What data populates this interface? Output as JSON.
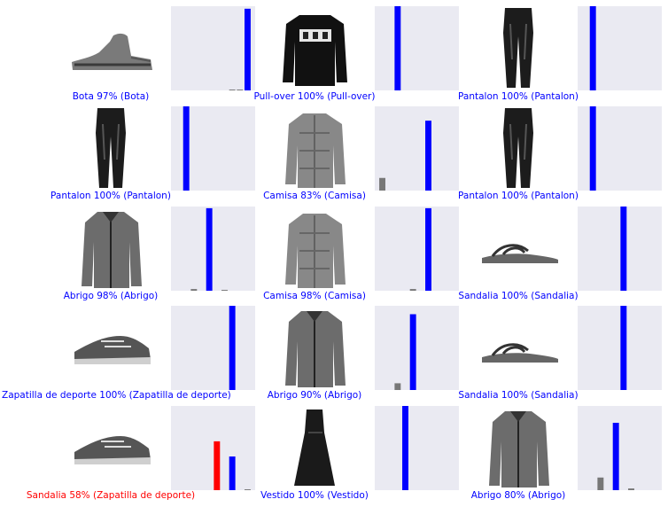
{
  "colors": {
    "panel_bg": "#eaeaf2",
    "correct": "#0000ff",
    "wrong": "#ff0000",
    "other": "#777777"
  },
  "chart_data": {
    "type": "bar",
    "description_note": "",
    "items": [
      {
        "image": "ankle-boot",
        "caption": "Bota 97% (Bota)",
        "correct": true,
        "values": [
          0,
          0,
          0,
          0,
          0,
          0,
          0,
          0.01,
          0.01,
          0.97
        ],
        "predicted": 9,
        "true_label": 9
      },
      {
        "image": "pullover",
        "caption": "Pull-over 100% (Pull-over)",
        "correct": true,
        "values": [
          0,
          0,
          1.0,
          0,
          0,
          0,
          0,
          0,
          0,
          0
        ],
        "predicted": 2,
        "true_label": 2
      },
      {
        "image": "trouser",
        "caption": "Pantalon 100% (Pantalon)",
        "correct": true,
        "values": [
          0,
          1.0,
          0,
          0,
          0,
          0,
          0,
          0,
          0,
          0
        ],
        "predicted": 1,
        "true_label": 1
      },
      {
        "image": "trouser",
        "caption": "Pantalon 100% (Pantalon)",
        "correct": true,
        "values": [
          0,
          1.0,
          0,
          0,
          0,
          0,
          0,
          0,
          0,
          0
        ],
        "predicted": 1,
        "true_label": 1
      },
      {
        "image": "shirt",
        "caption": "Camisa 83% (Camisa)",
        "correct": true,
        "values": [
          0.15,
          0,
          0,
          0,
          0,
          0,
          0.83,
          0,
          0,
          0
        ],
        "predicted": 6,
        "true_label": 6
      },
      {
        "image": "trouser",
        "caption": "Pantalon 100% (Pantalon)",
        "correct": true,
        "values": [
          0,
          1.0,
          0,
          0,
          0,
          0,
          0,
          0,
          0,
          0
        ],
        "predicted": 1,
        "true_label": 1
      },
      {
        "image": "coat",
        "caption": "Abrigo 98% (Abrigo)",
        "correct": true,
        "values": [
          0,
          0,
          0.02,
          0,
          0.98,
          0,
          0.01,
          0,
          0,
          0
        ],
        "predicted": 4,
        "true_label": 4
      },
      {
        "image": "shirt",
        "caption": "Camisa 98% (Camisa)",
        "correct": true,
        "values": [
          0,
          0,
          0,
          0,
          0.02,
          0,
          0.98,
          0,
          0,
          0
        ],
        "predicted": 6,
        "true_label": 6
      },
      {
        "image": "sandal",
        "caption": "Sandalia 100% (Sandalia)",
        "correct": true,
        "values": [
          0,
          0,
          0,
          0,
          0,
          1.0,
          0,
          0,
          0,
          0
        ],
        "predicted": 5,
        "true_label": 5
      },
      {
        "image": "sneaker",
        "caption": "Zapatilla de deporte 100% (Zapatilla de deporte)",
        "correct": true,
        "values": [
          0,
          0,
          0,
          0,
          0,
          0,
          0,
          1.0,
          0,
          0
        ],
        "predicted": 7,
        "true_label": 7
      },
      {
        "image": "coat",
        "caption": "Abrigo 90% (Abrigo)",
        "correct": true,
        "values": [
          0,
          0,
          0.08,
          0,
          0.9,
          0,
          0,
          0,
          0,
          0
        ],
        "predicted": 4,
        "true_label": 4
      },
      {
        "image": "sandal",
        "caption": "Sandalia 100% (Sandalia)",
        "correct": true,
        "values": [
          0,
          0,
          0,
          0,
          0,
          1.0,
          0,
          0,
          0,
          0
        ],
        "predicted": 5,
        "true_label": 5
      },
      {
        "image": "sneaker",
        "caption": "Sandalia 58% (Zapatilla de deporte)",
        "correct": false,
        "values": [
          0,
          0,
          0,
          0,
          0,
          0.58,
          0,
          0.4,
          0,
          0.01
        ],
        "predicted": 5,
        "true_label": 7
      },
      {
        "image": "dress",
        "caption": "Vestido 100% (Vestido)",
        "correct": true,
        "values": [
          0,
          0,
          0,
          1.0,
          0,
          0,
          0,
          0,
          0,
          0
        ],
        "predicted": 3,
        "true_label": 3
      },
      {
        "image": "coat",
        "caption": "Abrigo 80% (Abrigo)",
        "correct": true,
        "values": [
          0,
          0,
          0.15,
          0,
          0.8,
          0,
          0.02,
          0,
          0,
          0
        ],
        "predicted": 4,
        "true_label": 4
      }
    ],
    "ylim": [
      0,
      1
    ],
    "num_classes": 10,
    "grid": false
  }
}
